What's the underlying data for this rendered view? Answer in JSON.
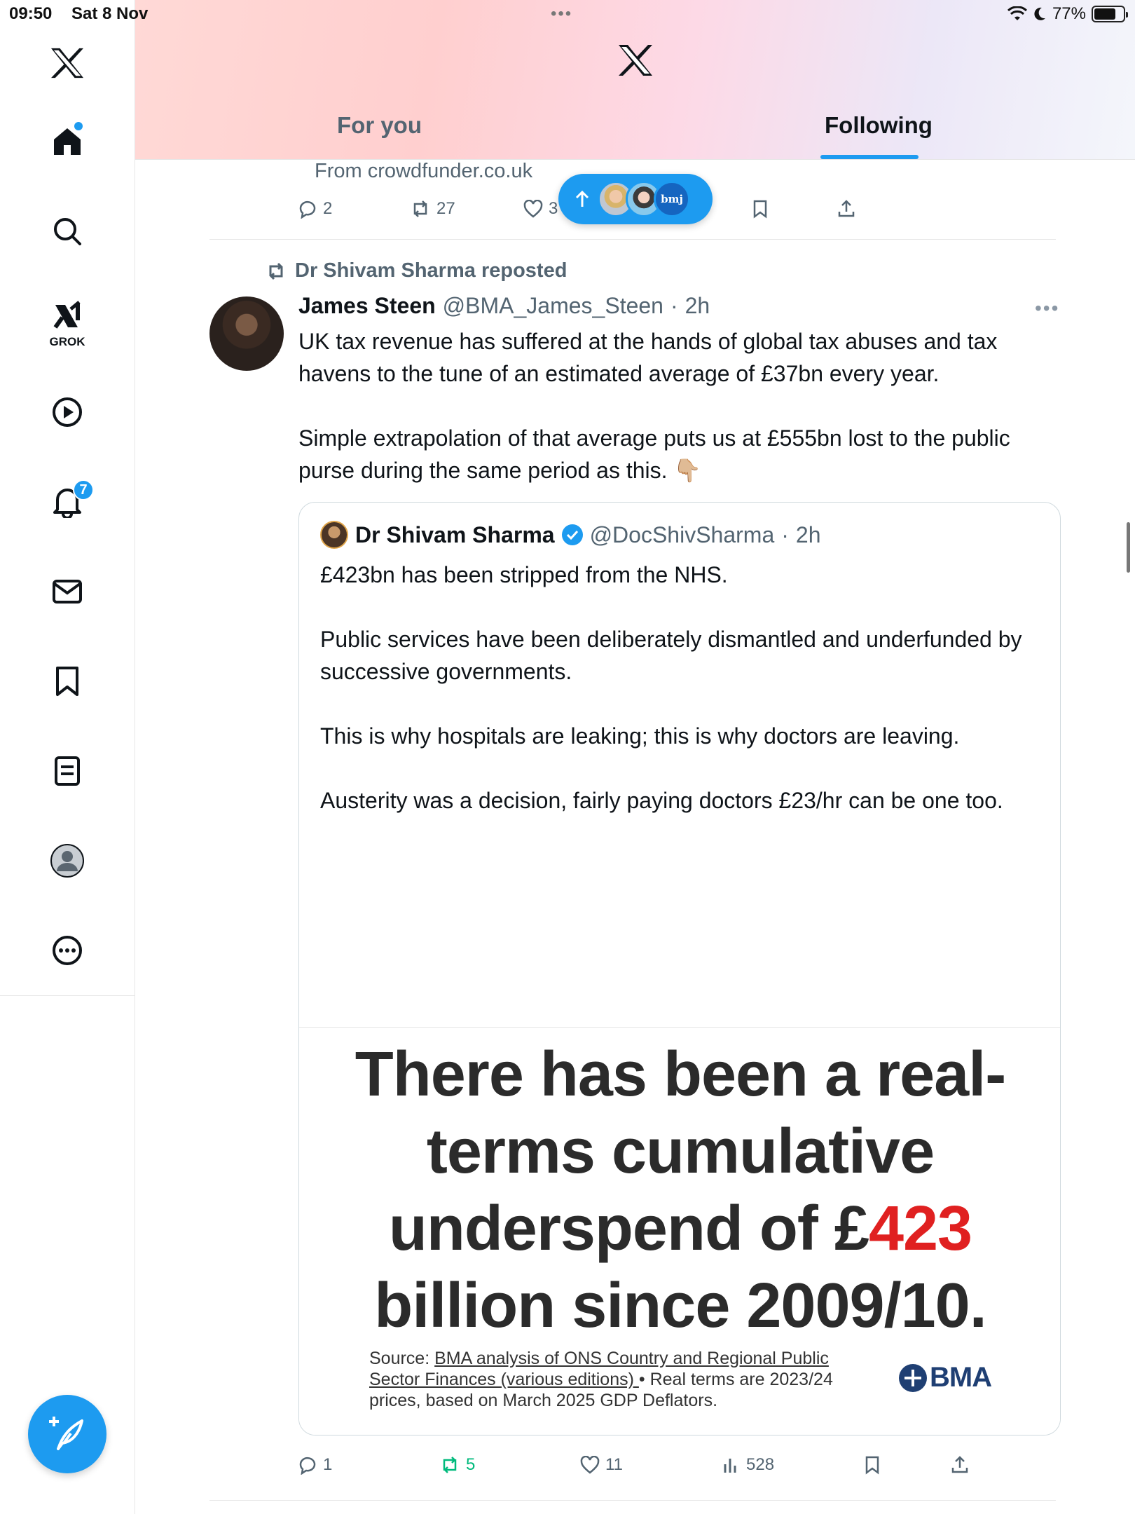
{
  "status_bar": {
    "time": "09:50",
    "date": "Sat 8 Nov",
    "battery": "77%",
    "battery_level": 0.77
  },
  "header": {
    "tabs": [
      {
        "label": "For you",
        "active": false
      },
      {
        "label": "Following",
        "active": true
      }
    ]
  },
  "sidebar": {
    "items": [
      {
        "name": "home",
        "icon": "home-icon"
      },
      {
        "name": "explore",
        "icon": "search-icon"
      },
      {
        "name": "grok",
        "icon": "grok-icon",
        "label": "GROK"
      },
      {
        "name": "video",
        "icon": "play-icon"
      },
      {
        "name": "notifications",
        "icon": "bell-icon",
        "badge": "7"
      },
      {
        "name": "messages",
        "icon": "mail-icon"
      },
      {
        "name": "bookmarks",
        "icon": "bookmark-icon"
      },
      {
        "name": "lists",
        "icon": "list-icon"
      },
      {
        "name": "profile",
        "icon": "profile-icon"
      },
      {
        "name": "more",
        "icon": "more-icon"
      }
    ]
  },
  "previous_post": {
    "link_source": "From crowdfunder.co.uk",
    "replies": "2",
    "reposts": "27",
    "likes": "3"
  },
  "post": {
    "repost_by": "Dr Shivam Sharma reposted",
    "author": "James Steen",
    "handle": "@BMA_James_Steen",
    "time": "2h",
    "paragraphs": [
      "UK tax revenue has suffered at the hands of global tax abuses and tax havens to the tune of an estimated average of £37bn every year.",
      "Simple extrapolation of that average puts us at £555bn lost to the public purse during the same period as this. 👇🏼"
    ],
    "quote": {
      "author": "Dr Shivam Sharma",
      "handle": "@DocShivSharma",
      "time": "2h",
      "paragraphs": [
        "£423bn has been stripped from the NHS.",
        "Public services have been deliberately dismantled and underfunded by successive governments.",
        "This is why hospitals are leaking; this is why doctors are leaving.",
        "Austerity was a decision, fairly paying doctors £23/hr can be one too."
      ],
      "image": {
        "headline_pre": "There has been a real-terms cumulative underspend of £",
        "headline_amount": "423",
        "headline_post": " billion since 2009/10.",
        "source_label": "Source: ",
        "source_link": "BMA analysis of ONS Country and Regional Public Sector Finances (various editions) ",
        "source_rest": "• Real terms are 2023/24 prices, based on March 2025 GDP Deflators.",
        "logo_text": "BMA"
      }
    },
    "replies": "1",
    "reposts": "5",
    "likes": "11",
    "views": "528"
  },
  "colors": {
    "accent": "#1d9bf0",
    "repost_active": "#00ba7c",
    "headline_red": "#e02020",
    "bma_navy": "#1f3f73"
  }
}
